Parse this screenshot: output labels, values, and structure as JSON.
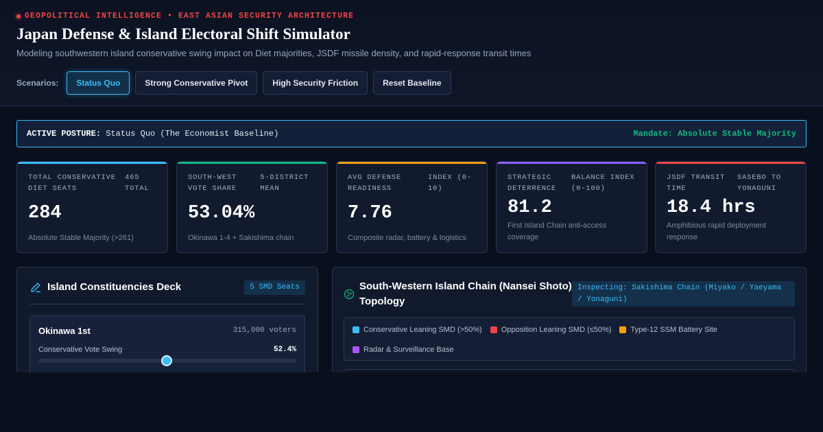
{
  "header": {
    "eyebrow": "GEOPOLITICAL INTELLIGENCE • EAST ASIAN SECURITY ARCHITECTURE",
    "title": "Japan Defense & Island Electoral Shift Simulator",
    "subtitle": "Modeling southwestern island conservative swing impact on Diet majorities, JSDF missile density, and rapid-response transit times",
    "scenarios_label": "Scenarios:",
    "scenarios": [
      {
        "label": "Status Quo",
        "active": true
      },
      {
        "label": "Strong Conservative Pivot",
        "active": false
      },
      {
        "label": "High Security Friction",
        "active": false
      },
      {
        "label": "Reset Baseline",
        "active": false
      }
    ]
  },
  "posture": {
    "label": "ACTIVE POSTURE:",
    "value": "Status Quo (The Economist Baseline)",
    "mandate": "Mandate: Absolute Stable Majority"
  },
  "cards": [
    {
      "head_a": "TOTAL CONSERVATIVE DIET SEATS",
      "head_b": "465 TOTAL",
      "value": "284",
      "note": "Absolute Stable Majority (>261)",
      "color": "#38bdf8"
    },
    {
      "head_a": "SOUTH-WEST VOTE SHARE",
      "head_b": "5-DISTRICT MEAN",
      "value": "53.04%",
      "note": "Okinawa 1-4 + Sakishima chain",
      "color": "#10b981"
    },
    {
      "head_a": "AVG DEFENSE READINESS",
      "head_b": "INDEX (0-10)",
      "value": "7.76",
      "note": "Composite radar, battery & logistics",
      "color": "#f59e0b"
    },
    {
      "head_a": "STRATEGIC DETERRENCE",
      "head_b": "BALANCE INDEX (0-100)",
      "value": "81.2",
      "note": "First Island Chain anti-access coverage",
      "color": "#8b5cf6"
    },
    {
      "head_a": "JSDF TRANSIT TIME",
      "head_b": "SASEBO TO YONAGUNI",
      "value": "18.4 hrs",
      "note": "Amphibious rapid deployment response",
      "color": "#ef4444"
    }
  ],
  "deck": {
    "title": "Island Constituencies Deck",
    "chip": "5 SMD Seats",
    "first": {
      "name": "Okinawa 1st",
      "voters": "315,000 voters",
      "swing_label": "Conservative Vote Swing",
      "swing_value": "52.4%",
      "swing_fraction": 0.5
    }
  },
  "topology": {
    "title": "South-Western Island Chain (Nansei Shoto) Topology",
    "chip": "Inspecting: Sakishima Chain (Miyako / Yaeyama / Yonaguni)",
    "legend": [
      {
        "label": "Conservative Leaning SMD (>50%)",
        "color": "#38bdf8"
      },
      {
        "label": "Opposition Leaning SMD (≤50%)",
        "color": "#ef4444"
      },
      {
        "label": "Type-12 SSM Battery Site",
        "color": "#f59e0b"
      },
      {
        "label": "Radar & Surveillance Base",
        "color": "#a855f7"
      }
    ]
  }
}
